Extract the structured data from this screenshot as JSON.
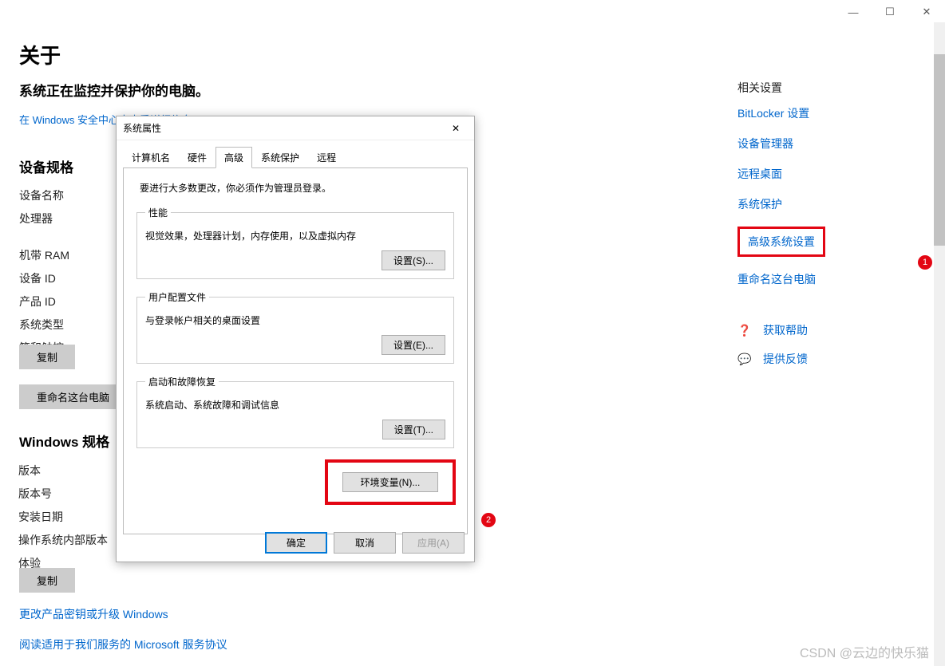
{
  "windowControls": {
    "min": "—",
    "max": "☐",
    "close": "✕"
  },
  "pageTitle": "关于",
  "subheading": "系统正在监控并保护你的电脑。",
  "securityLinkPrefix": "在 ",
  "securityLink": "Windows 安全中心中查看详细信息",
  "deviceSpec": {
    "title": "设备规格",
    "rows": [
      "设备名称",
      "处理器",
      "机带 RAM",
      "设备 ID",
      "产品 ID",
      "系统类型",
      "笔和触控"
    ],
    "copy": "复制",
    "rename": "重命名这台电脑"
  },
  "winSpec": {
    "title": "Windows 规格",
    "rows": [
      "版本",
      "版本号",
      "安装日期",
      "操作系统内部版本",
      "体验"
    ],
    "copy": "复制"
  },
  "bottomLinks": [
    "更改产品密钥或升级 Windows",
    "阅读适用于我们服务的 Microsoft 服务协议"
  ],
  "sidebar": {
    "heading": "相关设置",
    "links": [
      "BitLocker 设置",
      "设备管理器",
      "远程桌面",
      "系统保护",
      "高级系统设置",
      "重命名这台电脑"
    ],
    "help": "获取帮助",
    "feedback": "提供反馈"
  },
  "annotations": {
    "b1": "1",
    "b2": "2"
  },
  "dialog": {
    "title": "系统属性",
    "tabs": [
      "计算机名",
      "硬件",
      "高级",
      "系统保护",
      "远程"
    ],
    "activeTab": 2,
    "adminNote": "要进行大多数更改，你必须作为管理员登录。",
    "groups": [
      {
        "legend": "性能",
        "desc": "视觉效果，处理器计划，内存使用，以及虚拟内存",
        "btn": "设置(S)..."
      },
      {
        "legend": "用户配置文件",
        "desc": "与登录帐户相关的桌面设置",
        "btn": "设置(E)..."
      },
      {
        "legend": "启动和故障恢复",
        "desc": "系统启动、系统故障和调试信息",
        "btn": "设置(T)..."
      }
    ],
    "envBtn": "环境变量(N)...",
    "ok": "确定",
    "cancel": "取消",
    "apply": "应用(A)"
  },
  "watermark": "CSDN @云边的快乐猫"
}
